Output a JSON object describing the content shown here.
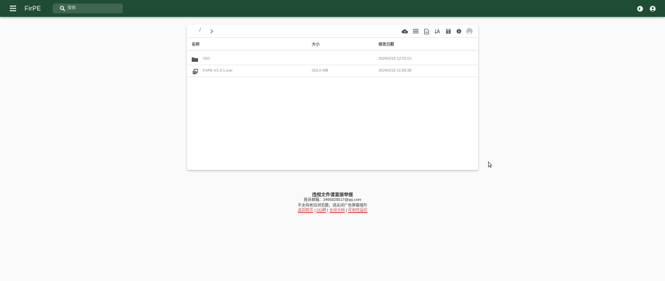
{
  "app": {
    "title": "FirPE"
  },
  "search": {
    "placeholder": "搜索"
  },
  "breadcrumb": {
    "root": "/"
  },
  "table": {
    "columns": {
      "name": "名称",
      "size": "大小",
      "modified": "修改日期"
    },
    "rows": [
      {
        "name": "ISO",
        "size": "",
        "modified": "2024/2/19 12:01:01",
        "type": "folder"
      },
      {
        "name": "FirPE-V1.9.1.exe",
        "size": "916.6 MB",
        "modified": "2024/2/19 11:59:38",
        "type": "executable"
      }
    ]
  },
  "footer": {
    "title": "违规文件请直接举报",
    "contact": "投诉邮箱：3496828517@qq.com",
    "notice": "不支持老旧浏览器，请关闭广告屏蔽插件",
    "links": {
      "home": "返回首页",
      "qq": "QQ群",
      "docs": "支持文档",
      "donate": "可用性监控"
    },
    "separator": "|"
  },
  "colors": {
    "appbar": "#1e4d31",
    "background": "#fafafa",
    "link": "#d83b3b"
  },
  "icons": {
    "menu": "menu-icon",
    "search": "search-icon",
    "theme": "brightness-icon",
    "account": "account-circle-icon",
    "toolbar": [
      "cloud-download-icon",
      "list-view-icon",
      "file-text-icon",
      "sort-az-icon",
      "save-icon",
      "info-icon",
      "avatar-icon"
    ]
  }
}
